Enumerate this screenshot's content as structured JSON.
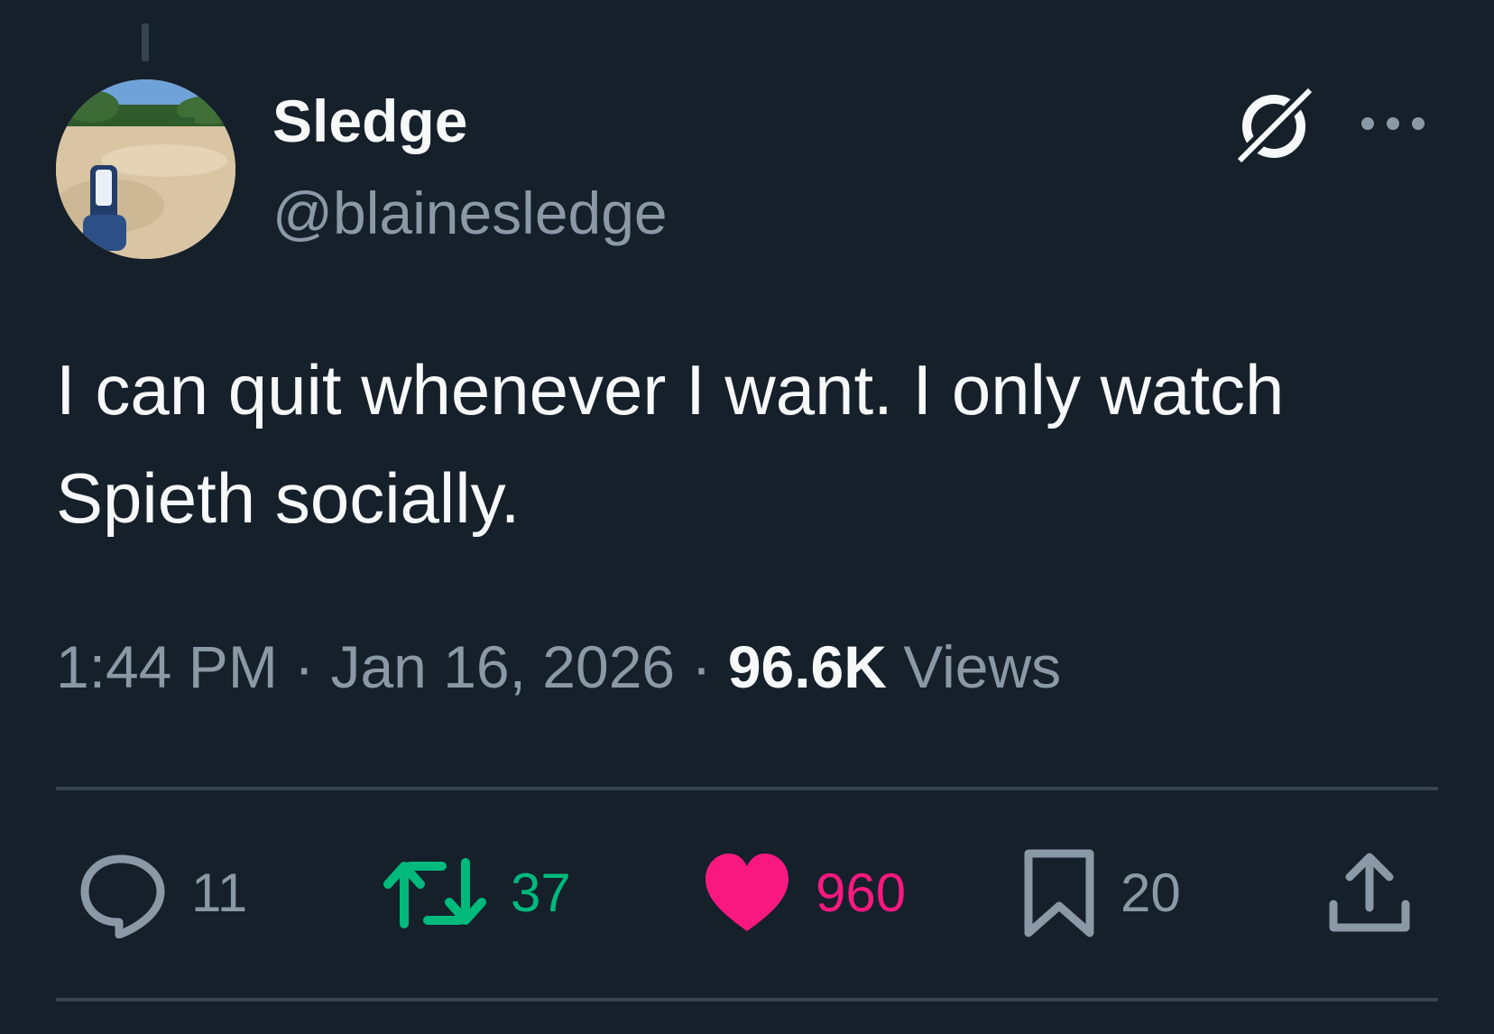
{
  "author": {
    "display_name": "Sledge",
    "handle": "@blainesledge"
  },
  "tweet": {
    "text": "I can quit whenever I want.  I only watch Spieth socially.",
    "time": "1:44 PM",
    "date": "Jan 16, 2026",
    "views_count": "96.6K",
    "views_label": "Views",
    "separator": "·"
  },
  "actions": {
    "replies": "11",
    "retweets": "37",
    "likes": "960",
    "bookmarks": "20"
  },
  "colors": {
    "background": "#15202b",
    "text": "#f7f9f9",
    "secondary_text": "#8b98a5",
    "divider": "#38444d",
    "retweet": "#00ba7c",
    "like": "#f91880"
  },
  "icons": {
    "header": [
      "grok-icon",
      "more-icon"
    ],
    "actions": [
      "reply-icon",
      "retweet-icon",
      "like-icon",
      "bookmark-icon",
      "share-icon"
    ]
  }
}
